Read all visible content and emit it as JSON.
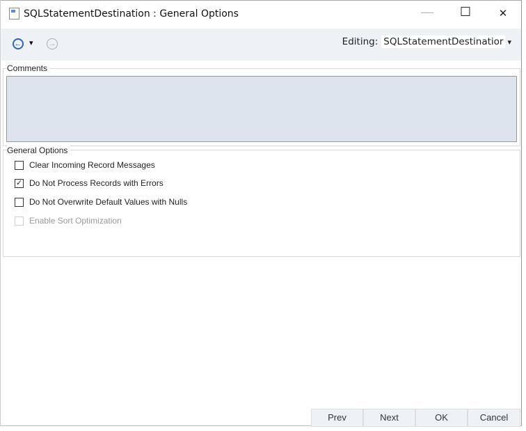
{
  "window": {
    "title": "SQLStatementDestination : General Options",
    "minimize": "—",
    "maximize": "☐",
    "close": "✕"
  },
  "toolbar": {
    "back": "←",
    "dropdown": "▾",
    "forward": "→",
    "editing_label": "Editing:",
    "editing_value": "SQLStatementDestinatior",
    "editing_arrow": "▾"
  },
  "comments": {
    "label": "Comments",
    "value": ""
  },
  "general_options": {
    "label": "General Options",
    "items": [
      {
        "label": "Clear Incoming Record Messages",
        "checked": false,
        "enabled": true
      },
      {
        "label": "Do Not Process Records with Errors",
        "checked": true,
        "enabled": true
      },
      {
        "label": "Do Not Overwrite Default Values with Nulls",
        "checked": false,
        "enabled": true
      },
      {
        "label": "Enable Sort Optimization",
        "checked": false,
        "enabled": false
      }
    ]
  },
  "buttons": {
    "prev": "Prev",
    "next": "Next",
    "ok": "OK",
    "cancel": "Cancel"
  }
}
